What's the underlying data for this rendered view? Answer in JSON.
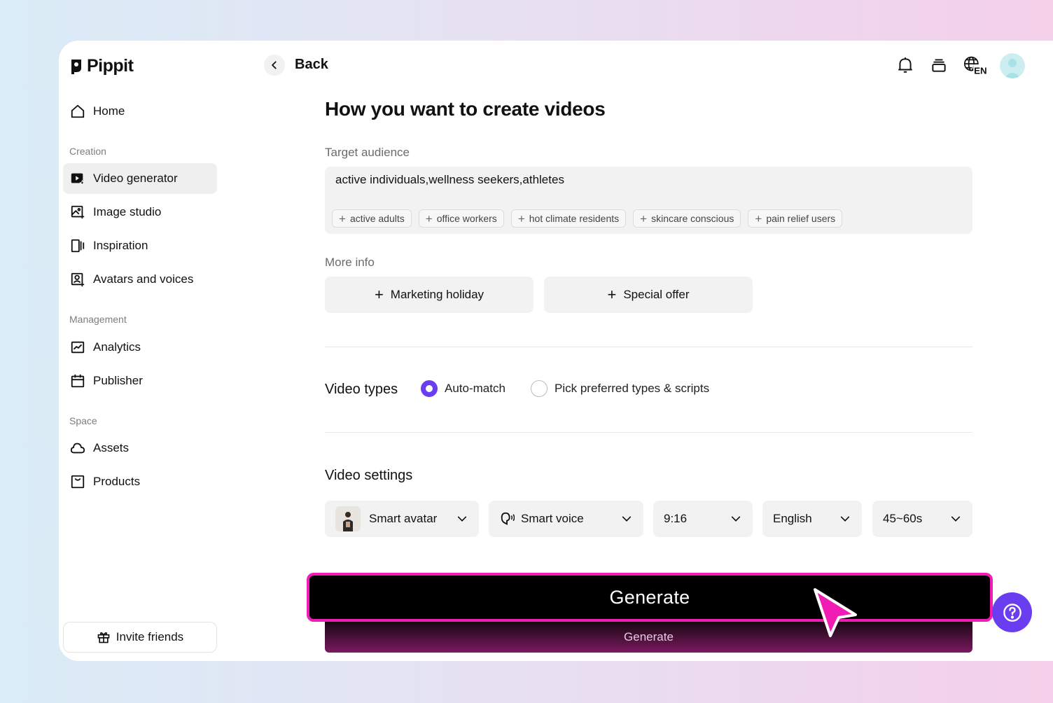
{
  "app": {
    "logo_text": "Pippit"
  },
  "sidebar": {
    "home": "Home",
    "creation_label": "Creation",
    "creation_items": [
      "Video generator",
      "Image studio",
      "Inspiration",
      "Avatars and voices"
    ],
    "management_label": "Management",
    "management_items": [
      "Analytics",
      "Publisher"
    ],
    "space_label": "Space",
    "space_items": [
      "Assets",
      "Products"
    ],
    "invite_label": "Invite friends"
  },
  "topbar": {
    "back_label": "Back",
    "language_badge": "EN"
  },
  "main": {
    "title": "How you want to create videos",
    "target_audience": {
      "label": "Target audience",
      "value": "active individuals,wellness seekers,athletes",
      "suggestions": [
        "active adults",
        "office workers",
        "hot climate residents",
        "skincare conscious",
        "pain relief users"
      ]
    },
    "more_info": {
      "label": "More info",
      "buttons": [
        "Marketing holiday",
        "Special offer"
      ]
    },
    "video_types": {
      "label": "Video types",
      "options": [
        "Auto-match",
        "Pick preferred types & scripts"
      ],
      "selected": "Auto-match"
    },
    "video_settings": {
      "label": "Video settings",
      "avatar": "Smart avatar",
      "voice": "Smart voice",
      "ratio": "9:16",
      "language": "English",
      "duration": "45~60s"
    },
    "generate_label": "Generate",
    "generate_highlight_label": "Generate"
  },
  "colors": {
    "accent": "#6a3df0",
    "highlight": "#f01cb3",
    "help": "#6a3df0"
  }
}
